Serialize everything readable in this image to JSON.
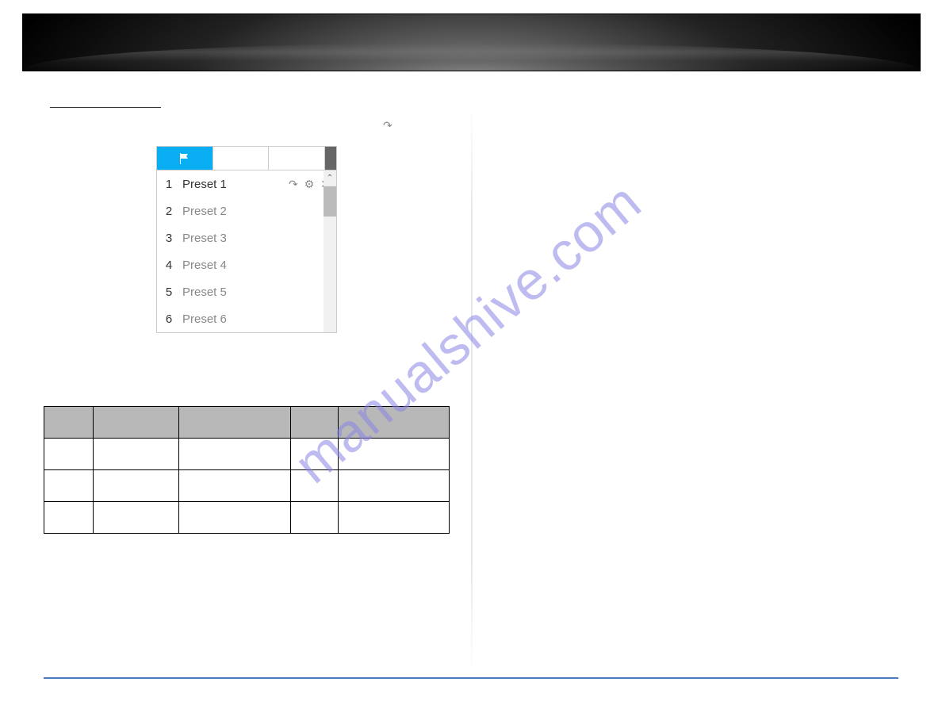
{
  "watermark": "manualshive.com",
  "presets": {
    "rows": [
      {
        "num": "1",
        "name": "Preset 1",
        "active": true
      },
      {
        "num": "2",
        "name": "Preset 2",
        "active": false
      },
      {
        "num": "3",
        "name": "Preset 3",
        "active": false
      },
      {
        "num": "4",
        "name": "Preset 4",
        "active": false
      },
      {
        "num": "5",
        "name": "Preset 5",
        "active": false
      },
      {
        "num": "6",
        "name": "Preset 6",
        "active": false
      }
    ]
  },
  "icons": {
    "flag": "flag-icon",
    "goto": "↷",
    "gear": "⚙",
    "close": "✕",
    "scroll_up": "⌃"
  }
}
